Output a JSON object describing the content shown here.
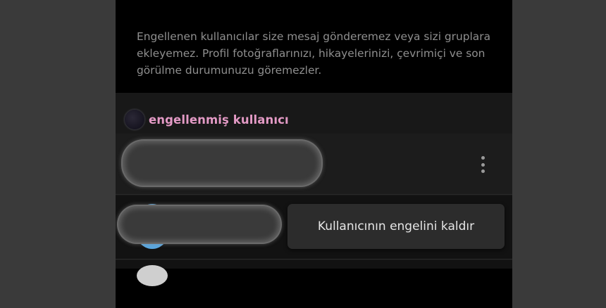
{
  "description": "Engellenen kullanıcılar size mesaj gönderemez veya sizi gruplara ekleyemez. Profil fotoğraflarınızı, hikayelerinizi, çevrimiçi ve son görülme durumunuzu göremezler.",
  "blocked_section": {
    "header_label": "engellenmiş kullanıcı"
  },
  "context_menu": {
    "unblock_label": "Kullanıcının engelini kaldır"
  },
  "icons": {
    "more": "more-vertical-icon"
  },
  "colors": {
    "accent": "#e39ac5",
    "avatar_blue": "#5aa7e0"
  }
}
